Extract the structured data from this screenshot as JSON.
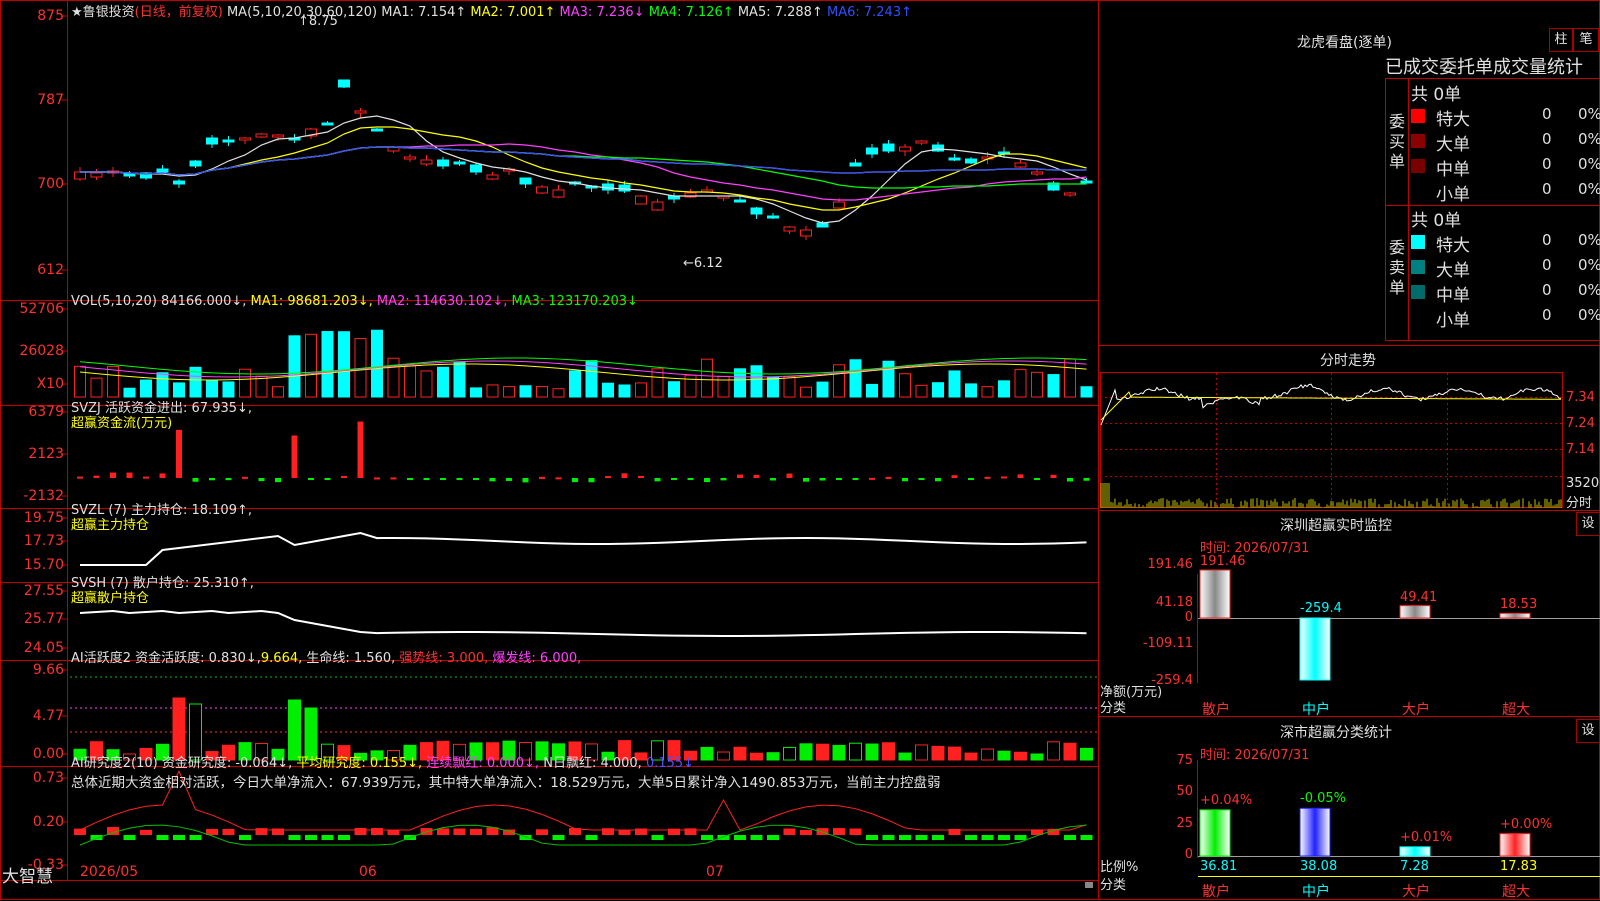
{
  "header": {
    "stock": "★鲁银投资",
    "mode": "(日线，前复权)",
    "ma_label": "MA(5,10,20,30,60,120)",
    "ma": [
      {
        "text": "MA1: 7.154↑",
        "color": "#e0e0e0"
      },
      {
        "text": "MA2: 7.001↑",
        "color": "#ffff00"
      },
      {
        "text": "MA3: 7.236↓",
        "color": "#ff40ff"
      },
      {
        "text": "MA4: 7.126↑",
        "color": "#00ff00"
      },
      {
        "text": "MA5: 7.288↑",
        "color": "#e0e0e0"
      },
      {
        "text": "MA6: 7.243↑",
        "color": "#3050ff"
      }
    ],
    "high_mark": "8.75",
    "low_mark": "6.12"
  },
  "axes": {
    "price": [
      "875",
      "787",
      "700",
      "612"
    ],
    "vol": [
      "52706",
      "26028",
      "X10"
    ],
    "svzj": [
      "6379",
      "2123",
      "-2132"
    ],
    "svzl": [
      "19.75",
      "17.73",
      "15.70"
    ],
    "svsh": [
      "27.55",
      "25.77",
      "24.05"
    ],
    "ai": [
      "9.66",
      "4.77",
      "0.00"
    ],
    "ai2": [
      "0.73",
      "0.20",
      "-0.33"
    ]
  },
  "panels": {
    "vol": {
      "title": "VOL(5,10,20)",
      "v": "84166.000↓,",
      "ma1": "MA1: 98681.203↓,",
      "ma2": "MA2: 114630.102↓,",
      "ma3": "MA3: 123170.203↓"
    },
    "svzj": {
      "title": "SVZJ  活跃资金进出: 67.935↓,",
      "sub": "超赢资金流(万元)"
    },
    "svzl": {
      "title": "SVZL (7) 主力持仓: 18.109↑,",
      "sub": "超赢主力持仓"
    },
    "svsh": {
      "title": "SVSH (7) 散户持仓: 25.310↑,",
      "sub": "超赢散户持仓"
    },
    "ai": {
      "t1": "AI活跃度2 资金活跃度: 0.830↓,",
      "t2": "9.664,",
      "t3": "生命线: 1.560,",
      "t4": "强势线: 3.000,",
      "t5": "爆发线: 6.000,"
    },
    "ai2": {
      "t1": "AI研究度2(10) 资金研究度: -0.064↓,",
      "t2": "平均研究度: 0.155↓,",
      "t3": "连续飘红: 0.000↓,",
      "t4": "N日飘红: 4.000,",
      "t5": "0.155↓",
      "note": "总体近期大资金相对活跃，今日大单净流入：67.939万元，其中特大单净流入：18.529万元，大单5日累计净入1490.853万元，当前主力控盘弱"
    }
  },
  "bottom": {
    "brand": "大智慧",
    "dates": [
      "2026/05",
      "06",
      "07"
    ]
  },
  "right": {
    "lhb_title": "龙虎看盘(逐单)",
    "btn1": "柱",
    "btn2": "笔",
    "stat_title": "已成交委托单成交量统计",
    "buy": {
      "label": "委买单",
      "total": "共 0单",
      "rows": [
        {
          "name": "特大",
          "n": "0",
          "p": "0%",
          "color": "#ff0000"
        },
        {
          "name": "大单",
          "n": "0",
          "p": "0%",
          "color": "#8b0000"
        },
        {
          "name": "中单",
          "n": "0",
          "p": "0%",
          "color": "#7a0000"
        },
        {
          "name": "小单",
          "n": "0",
          "p": "0%",
          "color": ""
        }
      ]
    },
    "sell": {
      "label": "委卖单",
      "total": "共 0单",
      "rows": [
        {
          "name": "特大",
          "n": "0",
          "p": "0%",
          "color": "#00ffff"
        },
        {
          "name": "大单",
          "n": "0",
          "p": "0%",
          "color": "#008080"
        },
        {
          "name": "中单",
          "n": "0",
          "p": "0%",
          "color": "#006b6b"
        },
        {
          "name": "小单",
          "n": "0",
          "p": "0%",
          "color": ""
        }
      ]
    },
    "intraday_title": "分时走势",
    "intraday_axis": [
      "7.34",
      "7.24",
      "7.14",
      "3520",
      "分时"
    ],
    "monitor": {
      "title": "深圳超赢实时监控",
      "btn": "设",
      "time": "时间: 2026/07/31",
      "axis": [
        "191.46",
        "41.18",
        "0",
        "-109.11",
        "-259.4"
      ],
      "ylabel": "净额(万元)",
      "xlabel": "分类",
      "bars": [
        {
          "cat": "散户",
          "value": 191.46,
          "label": "191.46"
        },
        {
          "cat": "中户",
          "value": -259.4,
          "label": "-259.4"
        },
        {
          "cat": "大户",
          "value": 49.41,
          "label": "49.41"
        },
        {
          "cat": "超大",
          "value": 18.53,
          "label": "18.53"
        }
      ]
    },
    "classify": {
      "title": "深市超赢分类统计",
      "btn": "设",
      "time": "时间: 2026/07/31",
      "axis": [
        "75",
        "50",
        "25",
        "0"
      ],
      "ylabel": "比例%",
      "xlabel": "分类",
      "bars": [
        {
          "cat": "散户",
          "value": 36.81,
          "label": "36.81",
          "chg": "+0.04%"
        },
        {
          "cat": "中户",
          "value": 38.08,
          "label": "38.08",
          "chg": "-0.05%"
        },
        {
          "cat": "大户",
          "value": 7.28,
          "label": "7.28",
          "chg": "+0.01%"
        },
        {
          "cat": "超大",
          "value": 17.83,
          "label": "17.83",
          "chg": "+0.00%"
        }
      ]
    }
  }
}
